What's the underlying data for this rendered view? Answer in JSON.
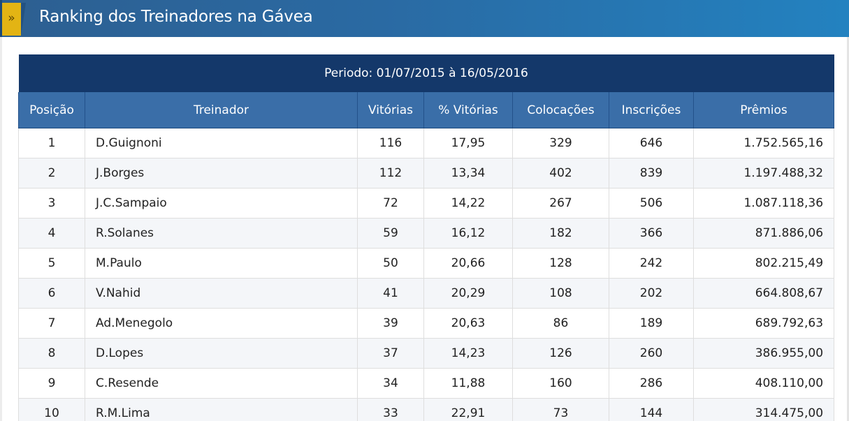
{
  "page": {
    "title": "Ranking dos Treinadores na Gávea",
    "chevron": "»"
  },
  "table": {
    "period": "Periodo: 01/07/2015 à 16/05/2016",
    "columns": [
      "Posição",
      "Treinador",
      "Vitórias",
      "% Vitórias",
      "Colocações",
      "Inscrições",
      "Prêmios"
    ],
    "rows": [
      [
        "1",
        "D.Guignoni",
        "116",
        "17,95",
        "329",
        "646",
        "1.752.565,16"
      ],
      [
        "2",
        "J.Borges",
        "112",
        "13,34",
        "402",
        "839",
        "1.197.488,32"
      ],
      [
        "3",
        "J.C.Sampaio",
        "72",
        "14,22",
        "267",
        "506",
        "1.087.118,36"
      ],
      [
        "4",
        "R.Solanes",
        "59",
        "16,12",
        "182",
        "366",
        "871.886,06"
      ],
      [
        "5",
        "M.Paulo",
        "50",
        "20,66",
        "128",
        "242",
        "802.215,49"
      ],
      [
        "6",
        "V.Nahid",
        "41",
        "20,29",
        "108",
        "202",
        "664.808,67"
      ],
      [
        "7",
        "Ad.Menegolo",
        "39",
        "20,63",
        "86",
        "189",
        "689.792,63"
      ],
      [
        "8",
        "D.Lopes",
        "37",
        "14,23",
        "126",
        "260",
        "386.955,00"
      ],
      [
        "9",
        "C.Resende",
        "34",
        "11,88",
        "160",
        "286",
        "408.110,00"
      ],
      [
        "10",
        "R.M.Lima",
        "33",
        "22,91",
        "73",
        "144",
        "314.475,00"
      ]
    ]
  },
  "colors": {
    "title_bar": "#2a6aa3",
    "chevron_box": "#e3b414",
    "period_row": "#14386a",
    "header_row": "#3a6ea8"
  }
}
